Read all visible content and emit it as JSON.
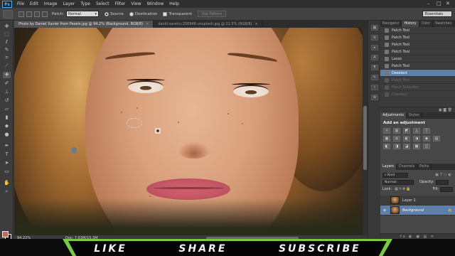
{
  "menubar": {
    "logo": "Ps",
    "items": [
      "File",
      "Edit",
      "Image",
      "Layer",
      "Type",
      "Select",
      "Filter",
      "View",
      "Window",
      "Help"
    ],
    "window_controls": [
      "–",
      "□",
      "✕"
    ]
  },
  "options": {
    "patch_label": "Patch:",
    "patch_value": "Normal",
    "source_label": "Source",
    "destination_label": "Destination",
    "transparent_label": "Transparent",
    "use_pattern_label": "Use Pattern",
    "workspace": "Essentials"
  },
  "tabs": [
    {
      "label": "Photo by Daniel Xavier from Pexels.jpg @ 94.2% (Background, RGB/8)",
      "active": true
    },
    {
      "label": "daniil-zaretiu-256946-unsplash.jpg @ 21.5% (RGB/8)",
      "active": false
    }
  ],
  "status": {
    "zoom": "94.22%",
    "doc": "Doc: 7.63M/15.3M"
  },
  "history": {
    "tabs": [
      "Navigator",
      "History",
      "Color",
      "Swatches"
    ],
    "active_tab": "History",
    "items": [
      {
        "label": "Patch Tool",
        "state": "normal"
      },
      {
        "label": "Patch Tool",
        "state": "normal"
      },
      {
        "label": "Patch Tool",
        "state": "normal"
      },
      {
        "label": "Patch Tool",
        "state": "normal"
      },
      {
        "label": "Lasso",
        "state": "normal"
      },
      {
        "label": "Patch Tool",
        "state": "normal"
      },
      {
        "label": "Deselect",
        "state": "selected"
      },
      {
        "label": "Patch Tool",
        "state": "undone"
      },
      {
        "label": "Patch Selection",
        "state": "undone"
      },
      {
        "label": "Deselect",
        "state": "undone"
      }
    ]
  },
  "adjustments": {
    "tabs": [
      "Adjustments",
      "Styles"
    ],
    "heading": "Add an adjustment",
    "icons": [
      "☼",
      "▥",
      "◩",
      "◬",
      "▽",
      "",
      "▦",
      "⚖",
      "◐",
      "◑",
      "◉",
      "▤",
      "◧",
      "◨",
      "◪",
      "▩",
      "◫",
      "▣"
    ]
  },
  "layers": {
    "tabs": [
      "Layers",
      "Channels",
      "Paths"
    ],
    "kind_label": "Kind",
    "blend_mode": "Normal",
    "opacity_label": "Opacity:",
    "lock_label": "Lock:",
    "fill_label": "Fill:",
    "items": [
      {
        "name": "Layer 2",
        "active": false,
        "visible": false
      },
      {
        "name": "Background",
        "active": true,
        "visible": true
      }
    ],
    "footer_icons": "fx ◐ ▣ ▤ ✕"
  },
  "banner": {
    "words": [
      "LIKE",
      "SHARE",
      "SUBSCRIBE"
    ]
  },
  "colors": {
    "accent_selected": "#5d7fa8",
    "banner_green": "#7ac943",
    "foreground_swatch": "#c06b5a",
    "background_swatch": "#111111"
  }
}
